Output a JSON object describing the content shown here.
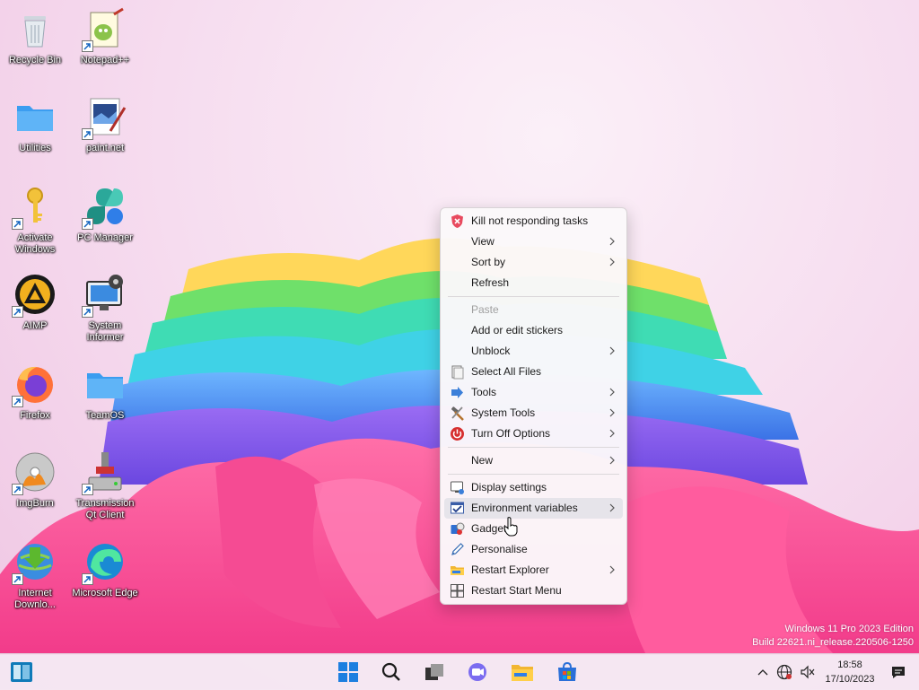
{
  "desktop_icons": [
    {
      "label": "Recycle Bin",
      "icon": "recycle-bin-icon"
    },
    {
      "label": "Notepad++",
      "icon": "notepad-plus-plus-icon"
    },
    {
      "label": "Utilities",
      "icon": "folder-icon"
    },
    {
      "label": "paint.net",
      "icon": "paint-net-icon"
    },
    {
      "label": "Activate Windows",
      "icon": "key-icon"
    },
    {
      "label": "PC Manager",
      "icon": "pc-manager-icon"
    },
    {
      "label": "AIMP",
      "icon": "aimp-icon"
    },
    {
      "label": "System Informer",
      "icon": "system-informer-icon"
    },
    {
      "label": "Firefox",
      "icon": "firefox-icon"
    },
    {
      "label": "TeamOS",
      "icon": "folder-icon"
    },
    {
      "label": "ImgBurn",
      "icon": "imgburn-icon"
    },
    {
      "label": "Transmission Qt Client",
      "icon": "transmission-icon"
    },
    {
      "label": "Internet Downlo...",
      "icon": "internet-download-manager-icon"
    },
    {
      "label": "Microsoft Edge",
      "icon": "edge-icon"
    }
  ],
  "context_menu": {
    "items": [
      {
        "label": "Kill not responding tasks",
        "icon": "kill-task-shield-icon"
      },
      {
        "label": "View",
        "submenu": true
      },
      {
        "label": "Sort by",
        "submenu": true
      },
      {
        "label": "Refresh"
      },
      {
        "label": "Paste",
        "disabled": true
      },
      {
        "label": "Add or edit stickers"
      },
      {
        "label": "Unblock",
        "submenu": true
      },
      {
        "label": "Select All Files",
        "icon": "select-all-icon"
      },
      {
        "label": "Tools",
        "icon": "tools-arrow-icon",
        "submenu": true
      },
      {
        "label": "System Tools",
        "icon": "hammer-icon",
        "submenu": true
      },
      {
        "label": "Turn Off Options",
        "icon": "power-icon",
        "submenu": true
      },
      {
        "label": "New",
        "submenu": true
      },
      {
        "label": "Display settings",
        "icon": "display-settings-icon"
      },
      {
        "label": "Environment variables",
        "icon": "environment-variables-icon",
        "submenu": true,
        "highlighted": true
      },
      {
        "label": "Gadgets",
        "icon": "gadgets-icon"
      },
      {
        "label": "Personalise",
        "icon": "personalise-pen-icon"
      },
      {
        "label": "Restart Explorer",
        "icon": "explorer-folder-icon",
        "submenu": true
      },
      {
        "label": "Restart Start Menu",
        "icon": "windows-logo-icon"
      }
    ]
  },
  "watermark": {
    "edition": "Windows 11 Pro 2023 Edition",
    "build": "Build 22621.ni_release.220506-1250"
  },
  "taskbar": {
    "buttons": [
      "widgets-icon",
      "start-icon",
      "search-icon",
      "task-view-icon",
      "teams-chat-icon",
      "file-explorer-icon",
      "microsoft-store-icon"
    ],
    "clock": {
      "time": "18:58",
      "date": "17/10/2023"
    }
  },
  "colors": {
    "accent": "#0067c0",
    "menu_highlight": "#e6e4ea"
  }
}
